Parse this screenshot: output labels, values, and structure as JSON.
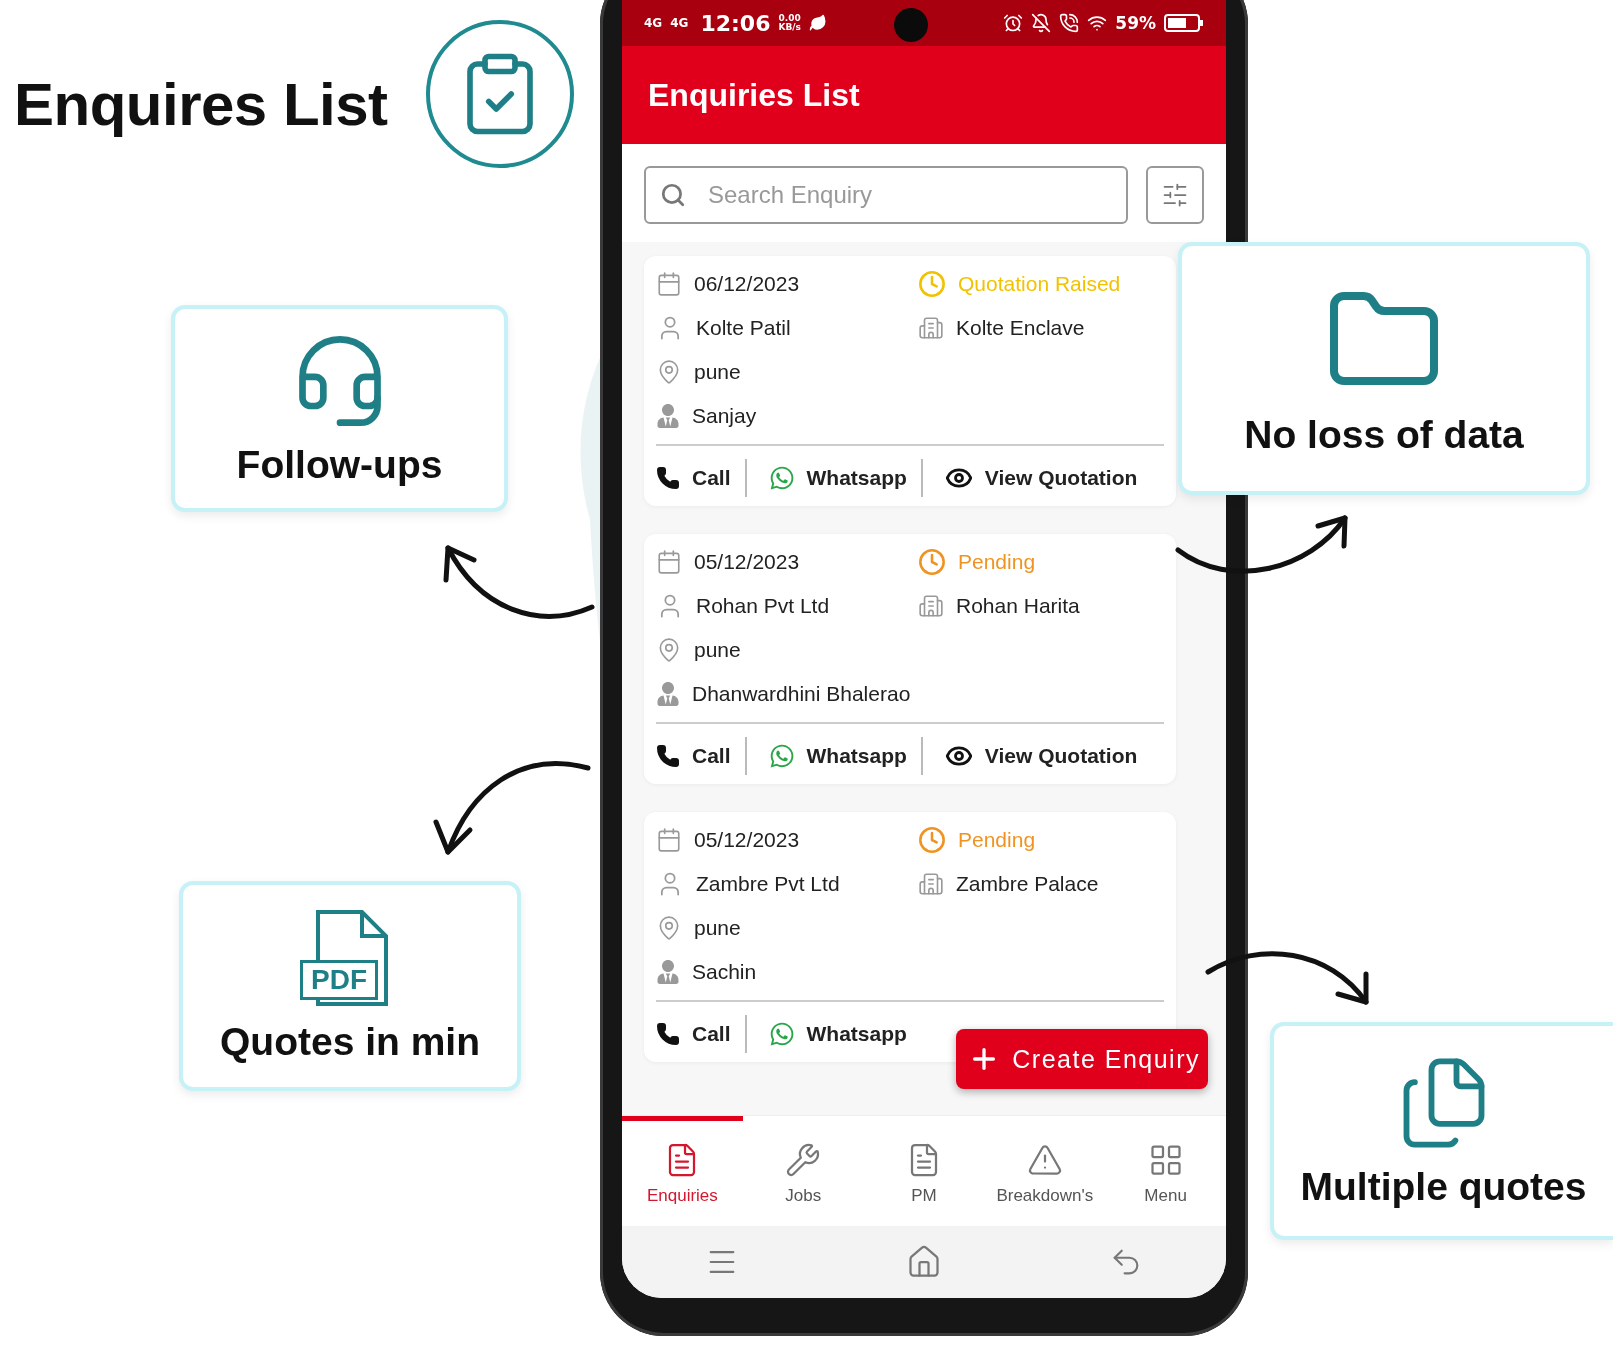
{
  "heading": {
    "title": "Enquires List"
  },
  "features": [
    {
      "kind": "headset",
      "label": "Follow-ups"
    },
    {
      "kind": "folder",
      "label": "No loss of data"
    },
    {
      "kind": "pdf",
      "label": "Quotes in min",
      "badge": "PDF"
    },
    {
      "kind": "documents",
      "label": "Multiple quotes"
    }
  ],
  "phone": {
    "status_bar": {
      "signals": [
        "4G",
        "4G"
      ],
      "time": "12:06",
      "speed": "0.00",
      "speed_unit": "KB/s",
      "battery": "59%"
    },
    "app_bar": {
      "title": "Enquiries List"
    },
    "search": {
      "placeholder": "Search Enquiry"
    },
    "enquiries": [
      {
        "date": "06/12/2023",
        "status": "Quotation Raised",
        "color": "#f2c200",
        "customer": "Kolte Patil",
        "site": "Kolte Enclave",
        "city": "pune",
        "contact": "Sanjay",
        "actions": [
          {
            "kind": "call",
            "label": "Call"
          },
          {
            "kind": "whatsapp",
            "label": "Whatsapp"
          },
          {
            "kind": "view",
            "label": "View Quotation"
          }
        ]
      },
      {
        "date": "05/12/2023",
        "status": "Pending",
        "color": "#ef9422",
        "customer": "Rohan Pvt Ltd",
        "site": "Rohan Harita",
        "city": "pune",
        "contact": "Dhanwardhini Bhalerao",
        "actions": [
          {
            "kind": "call",
            "label": "Call"
          },
          {
            "kind": "whatsapp",
            "label": "Whatsapp"
          },
          {
            "kind": "view",
            "label": "View Quotation"
          }
        ]
      },
      {
        "date": "05/12/2023",
        "status": "Pending",
        "color": "#ef9422",
        "customer": "Zambre Pvt Ltd",
        "site": "Zambre Palace",
        "city": "pune",
        "contact": "Sachin",
        "actions": [
          {
            "kind": "call",
            "label": "Call"
          },
          {
            "kind": "whatsapp",
            "label": "Whatsapp"
          }
        ]
      }
    ],
    "fab": {
      "label": "Create Enquiry"
    },
    "nav": [
      {
        "kind": "enquiries",
        "label": "Enquiries",
        "selected": true
      },
      {
        "kind": "jobs",
        "label": "Jobs",
        "selected": false
      },
      {
        "kind": "pm",
        "label": "PM",
        "selected": false
      },
      {
        "kind": "breakdowns",
        "label": "Breakdown's",
        "selected": false
      },
      {
        "kind": "menu",
        "label": "Menu",
        "selected": false
      }
    ]
  }
}
